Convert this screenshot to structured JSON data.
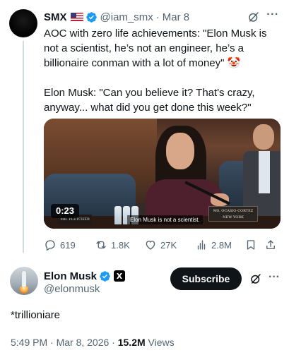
{
  "quoted_tweet": {
    "name": "SMX",
    "handle": "@iam_smx",
    "separator": "·",
    "date": "Mar 8",
    "text_line1": "AOC with zero life achievements: \"Elon Musk is not a scientist, he’s not an engineer, he’s a billionaire conman with a lot of money\" 🤡",
    "text_line2": "Elon Musk: \"Can you believe it? That's crazy, anyway... what did you get done this week?\"",
    "video": {
      "duration": "0:23",
      "caption": "Elon Musk is not a scientist.",
      "nameplate_left": "MR. FLETCHER",
      "nameplate_right_line1": "MS. OCASIO-CORTEZ",
      "nameplate_right_line2": "NEW YORK"
    },
    "actions": {
      "replies": "619",
      "reposts": "1.8K",
      "likes": "27K",
      "views": "2.8M"
    }
  },
  "main_tweet": {
    "name": "Elon Musk",
    "x_badge": "X",
    "handle": "@elonmusk",
    "subscribe_label": "Subscribe",
    "text": "*trillioniare",
    "timestamp": "5:49 PM · Mar 8, 2026 · ",
    "views_count": "15.2M",
    "views_label": " Views"
  },
  "colors": {
    "verified_blue": "#1d9bf0",
    "text_primary": "#0f1419",
    "text_secondary": "#536471"
  }
}
